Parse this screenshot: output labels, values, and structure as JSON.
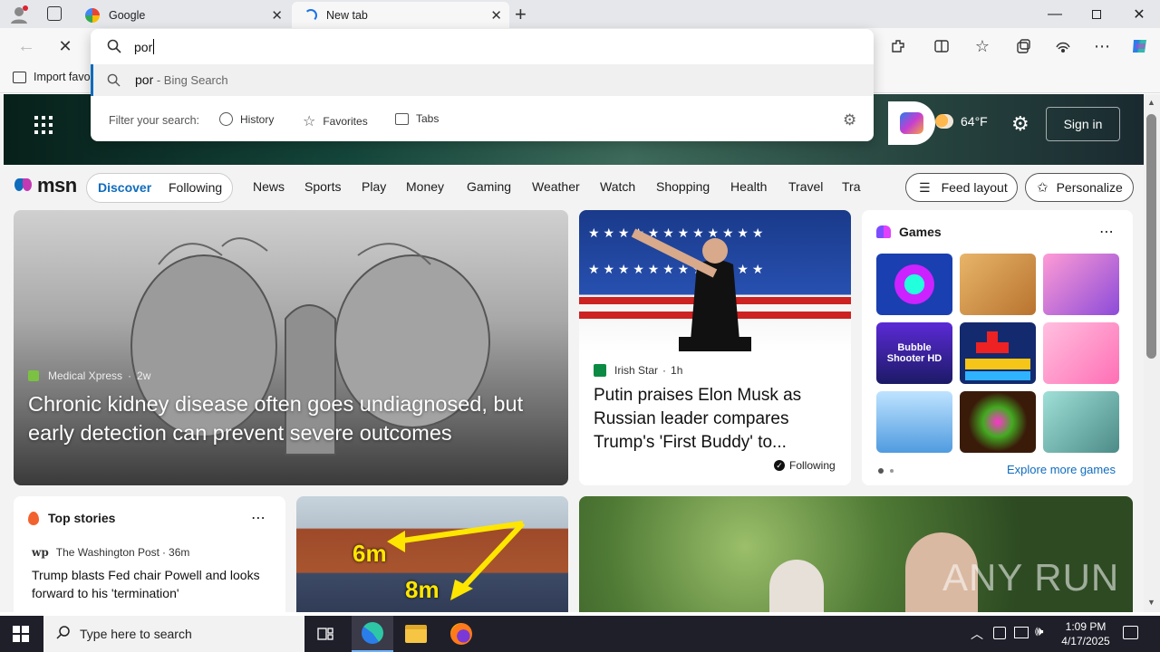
{
  "browser": {
    "tabs": [
      {
        "title": "Google"
      },
      {
        "title": "New tab"
      }
    ],
    "address_value": "por",
    "suggestion": {
      "query": "por",
      "source": " - Bing Search"
    },
    "filter": {
      "label": "Filter your search:",
      "history": "History",
      "favorites": "Favorites",
      "tabs": "Tabs"
    },
    "favorites_bar_item": "Import favo"
  },
  "msn": {
    "logo": "msn",
    "weather_temp": "64°F",
    "sign_in": "Sign in",
    "tabs": [
      "Discover",
      "Following"
    ],
    "nav": [
      "News",
      "Sports",
      "Play",
      "Money",
      "Gaming",
      "Weather",
      "Watch",
      "Shopping",
      "Health",
      "Travel",
      "Tra"
    ],
    "feed_layout": "Feed layout",
    "personalize": "Personalize"
  },
  "hero_story": {
    "source": "Medical Xpress",
    "age": "2w",
    "title": "Chronic kidney disease often goes undiagnosed, but early detection can prevent severe outcomes"
  },
  "story2": {
    "source": "Irish Star",
    "age": "1h",
    "title": "Putin praises Elon Musk as Russian leader compares Trump's 'First Buddy' to...",
    "following": "Following"
  },
  "games": {
    "title": "Games",
    "tiles": [
      "Bubble Shooter HD"
    ],
    "explore": "Explore more games"
  },
  "top_stories": {
    "title": "Top stories",
    "source": "The Washington Post",
    "age": "36m",
    "headline": "Trump blasts Fed chair Powell and looks forward to his 'termination'"
  },
  "solar_card": {
    "label1": "6m",
    "label2": "8m"
  },
  "watermark": "ANY RUN",
  "taskbar": {
    "search_placeholder": "Type here to search",
    "time": "1:09 PM",
    "date": "4/17/2025"
  },
  "colors": {
    "accent": "#0f6cbd",
    "taskbar": "#1f1f2a",
    "msn_blue": "#0078d4"
  }
}
